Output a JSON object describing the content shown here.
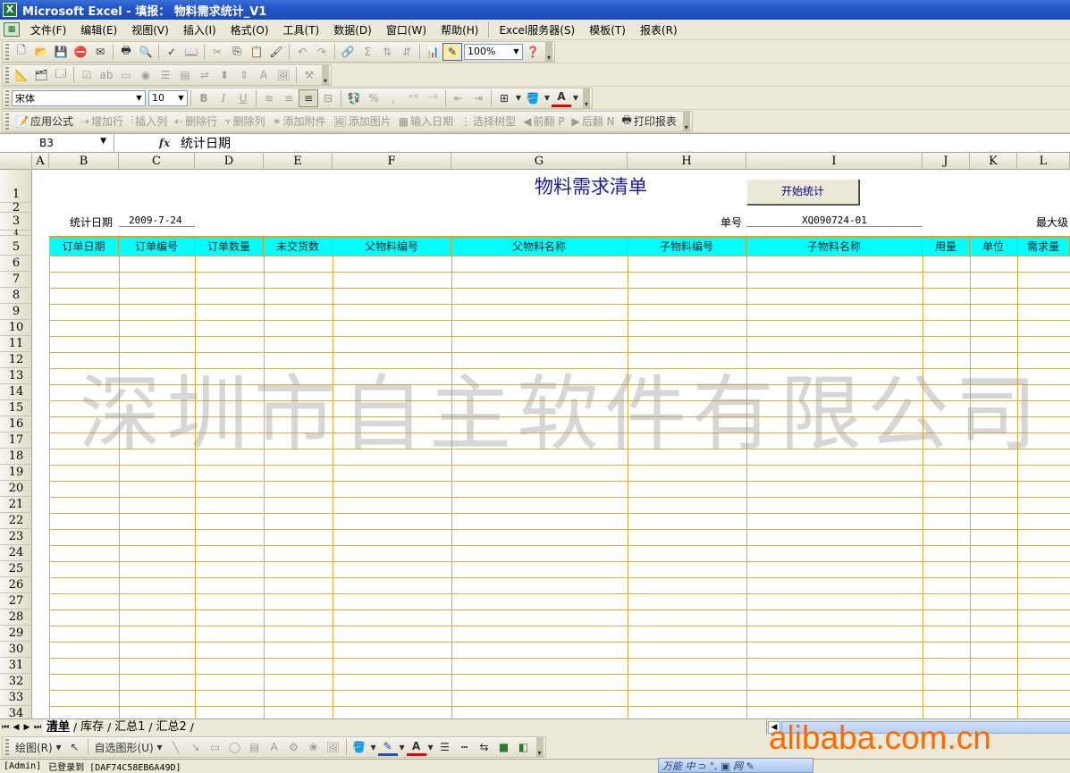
{
  "window": {
    "title": "Microsoft Excel - 填报： 物料需求统计_V1"
  },
  "menu": [
    "文件(F)",
    "编辑(E)",
    "视图(V)",
    "插入(I)",
    "格式(O)",
    "工具(T)",
    "数据(D)",
    "窗口(W)",
    "帮助(H)",
    "Excel服务器(S)",
    "模板(T)",
    "报表(R)"
  ],
  "standard_toolbar": {
    "zoom": "100%"
  },
  "format_toolbar": {
    "font": "宋体",
    "size": "10"
  },
  "report_toolbar": {
    "items": [
      {
        "label": "应用公式",
        "enabled": true
      },
      {
        "label": "增加行",
        "enabled": false
      },
      {
        "label": "插入列",
        "enabled": false
      },
      {
        "label": "删除行",
        "enabled": false
      },
      {
        "label": "删除列",
        "enabled": false
      },
      {
        "label": "添加附件",
        "enabled": false
      },
      {
        "label": "添加图片",
        "enabled": false
      },
      {
        "label": "输入日期",
        "enabled": false
      },
      {
        "label": "选择树型",
        "enabled": false
      },
      {
        "label": "前翻 P",
        "enabled": false
      },
      {
        "label": "后翻 N",
        "enabled": false
      },
      {
        "label": "打印报表",
        "enabled": true
      }
    ]
  },
  "formula_bar": {
    "name_box": "B3",
    "fx": "fx",
    "content": "统计日期"
  },
  "columns": [
    "A",
    "B",
    "C",
    "D",
    "E",
    "F",
    "G",
    "H",
    "I",
    "J",
    "K",
    "L"
  ],
  "rows": [
    "1",
    "2",
    "3",
    "4",
    "5",
    "6",
    "7",
    "8",
    "9",
    "10",
    "11",
    "12",
    "13",
    "14",
    "15",
    "16",
    "17",
    "18",
    "19",
    "20",
    "21",
    "22",
    "23",
    "24",
    "25",
    "26",
    "27",
    "28",
    "29",
    "30",
    "31",
    "32",
    "33",
    "34"
  ],
  "sheet": {
    "title": "物料需求清单",
    "start_button": "开始统计",
    "stat_date_label": "统计日期",
    "stat_date": "2009-7-24",
    "order_no_label": "单号",
    "order_no": "XQ090724-01",
    "max_level_label": "最大级",
    "headers": [
      "订单日期",
      "订单编号",
      "订单数量",
      "未交货数",
      "父物料编号",
      "父物料名称",
      "子物料编号",
      "子物料名称",
      "用量",
      "单位",
      "需求量"
    ],
    "watermark": "深圳市自主软件有限公司"
  },
  "sheet_tabs": [
    {
      "label": "清单",
      "active": true
    },
    {
      "label": "库存",
      "active": false
    },
    {
      "label": "汇总1",
      "active": false
    },
    {
      "label": "汇总2",
      "active": false
    }
  ],
  "drawing_toolbar": {
    "draw": "绘图(R)",
    "autoshapes": "自选图形(U)"
  },
  "status": {
    "user": "[Admin]",
    "login": "已登录到 [DAF74C58EB6A49D]"
  },
  "ime": {
    "label": "万能 中 ⊃ °, ▣ 网 ✎"
  },
  "watermark_site": "alibaba.com.cn"
}
